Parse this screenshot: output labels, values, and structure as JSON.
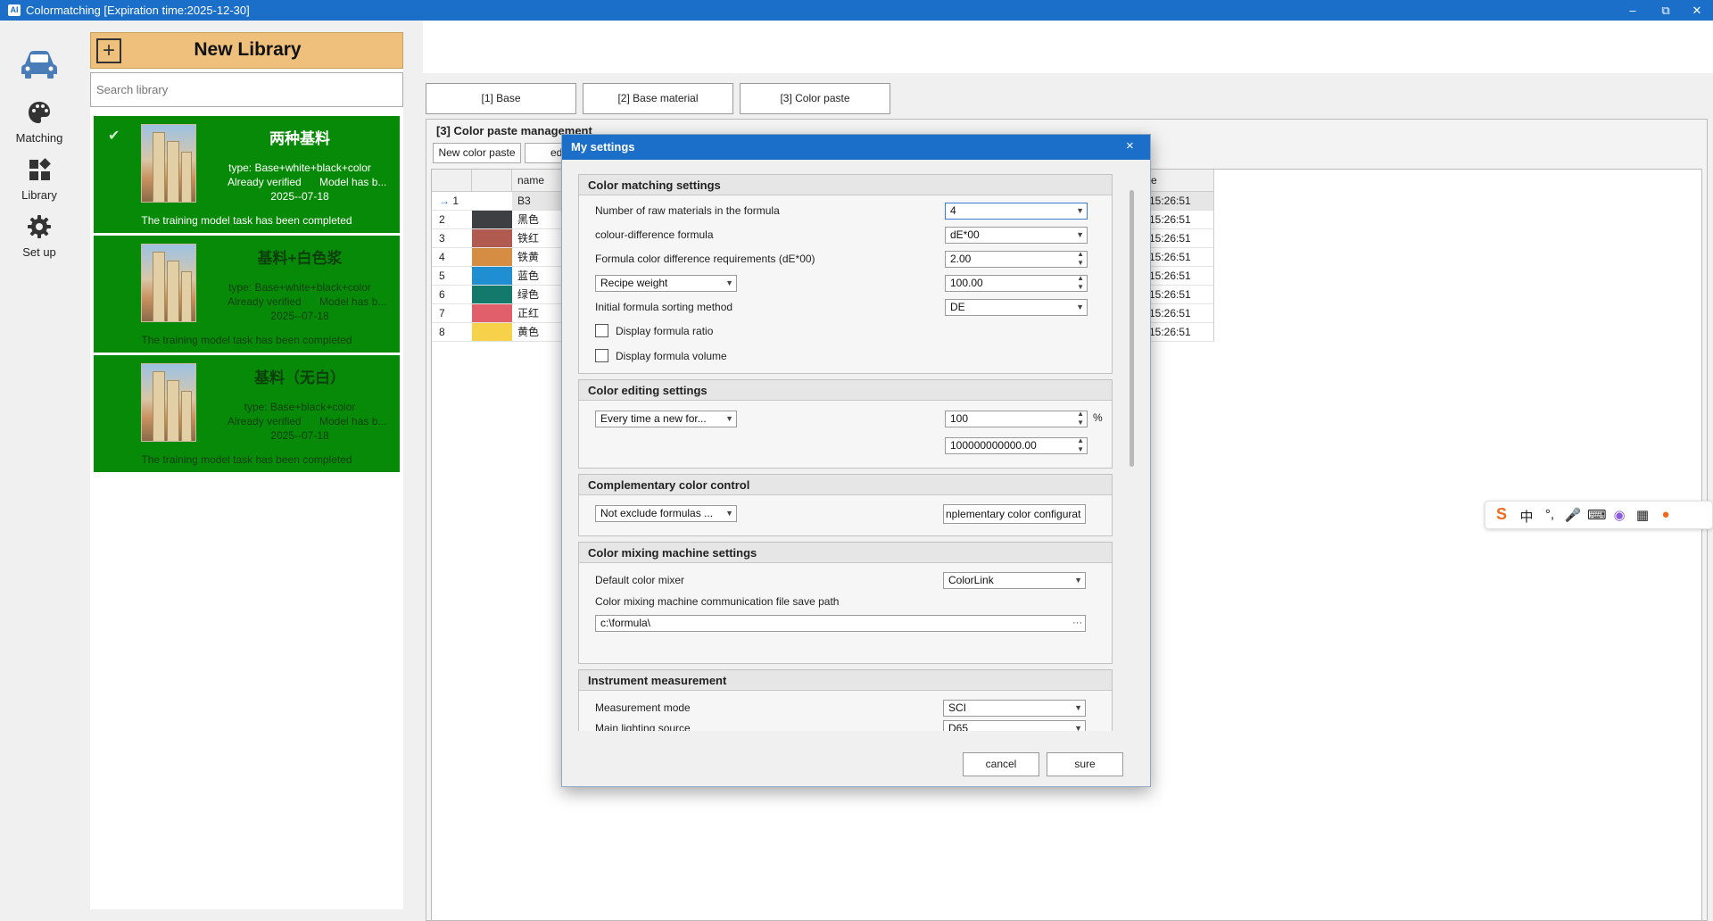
{
  "window": {
    "title": "Colormatching  [Expiration time:2025-12-30]",
    "logo": "AI"
  },
  "nav": [
    {
      "label": "",
      "icon": "car-icon"
    },
    {
      "label": "Matching",
      "icon": "palette-icon"
    },
    {
      "label": "Library",
      "icon": "library-icon"
    },
    {
      "label": "Set up",
      "icon": "gear-icon"
    }
  ],
  "library": {
    "new_label": "New Library",
    "search_placeholder": "Search library",
    "cards": [
      {
        "name": "两种基料",
        "type": "type: Base+white+black+color",
        "verified": "Already verified",
        "model": "Model has b...",
        "date": "2025--07-18",
        "status": "The training model task has been completed"
      },
      {
        "name": "基料+白色浆",
        "type": "type: Base+white+black+color",
        "verified": "Already verified",
        "model": "Model has b...",
        "date": "2025--07-18",
        "status": "The training model task has been completed"
      },
      {
        "name": "基料（无白）",
        "type": "type: Base+black+color",
        "verified": "Already verified",
        "model": "Model has b...",
        "date": "2025--07-18",
        "status": "The training model task has been completed"
      }
    ]
  },
  "tabs": [
    "[1] Base",
    "[2] Base material",
    "[3] Color paste"
  ],
  "management": {
    "title": "[3] Color paste management",
    "new_button": "New color paste",
    "edit_button": "ed",
    "header_name": "name",
    "header_time": "e",
    "rows": [
      {
        "no": "1",
        "color": "#ffffff",
        "name": "B3",
        "time": "15:26:51"
      },
      {
        "no": "2",
        "color": "#3d3f42",
        "name": "黑色",
        "time": "15:26:51"
      },
      {
        "no": "3",
        "color": "#b15a50",
        "name": "铁红",
        "time": "15:26:51"
      },
      {
        "no": "4",
        "color": "#d48d42",
        "name": "铁黄",
        "time": "15:26:51"
      },
      {
        "no": "5",
        "color": "#1f8fd1",
        "name": "蓝色",
        "time": "15:26:51"
      },
      {
        "no": "6",
        "color": "#137a6b",
        "name": "绿色",
        "time": "15:26:51"
      },
      {
        "no": "7",
        "color": "#e05f6a",
        "name": "正红",
        "time": "15:26:51"
      },
      {
        "no": "8",
        "color": "#f7d14a",
        "name": "黄色",
        "time": "15:26:51"
      }
    ],
    "current_row_marker": "→"
  },
  "dialog": {
    "title": "My settings",
    "close": "×",
    "groups": {
      "matching": {
        "title": "Color matching settings",
        "raw_materials_label": "Number of raw materials in the formula",
        "raw_materials_value": "4",
        "diff_formula_label": "colour-difference formula",
        "diff_formula_value": "dE*00",
        "diff_req_label": "Formula color difference requirements (dE*00)",
        "diff_req_value": "2.00",
        "recipe_weight_select": "Recipe weight",
        "recipe_weight_value": "100.00",
        "sorting_label": "Initial formula sorting method",
        "sorting_value": "DE",
        "ratio_label": "Display formula ratio",
        "volume_label": "Display formula volume"
      },
      "editing": {
        "title": "Color editing settings",
        "mode_select": "Every time a new for...",
        "percent_value": "100",
        "percent_unit": "%",
        "max_value": "100000000000.00"
      },
      "complementary": {
        "title": "Complementary color control",
        "mode_select": "Not exclude formulas ...",
        "config_value": "nplementary color configurat"
      },
      "mixer": {
        "title": "Color mixing machine settings",
        "default_label": "Default color mixer",
        "default_value": "ColorLink",
        "path_label": "Color mixing machine communication file save path",
        "path_value": "c:\\formula\\",
        "browse": "···"
      },
      "instrument": {
        "title": "Instrument measurement",
        "mode_label": "Measurement mode",
        "mode_value": "SCI",
        "light_label": "Main lighting source",
        "light_value": "D65"
      }
    },
    "cancel": "cancel",
    "ok": "sure"
  },
  "ime": {
    "logo": "S",
    "lang": "中",
    "icons": [
      "punctuation-icon",
      "microphone-icon",
      "keyboard-icon",
      "skin-icon",
      "toolbox-icon",
      "mascot-icon"
    ]
  },
  "colors": {
    "title_bar": "#1b6fc9",
    "card_green": "#078a07",
    "new_library": "#efc07b"
  }
}
